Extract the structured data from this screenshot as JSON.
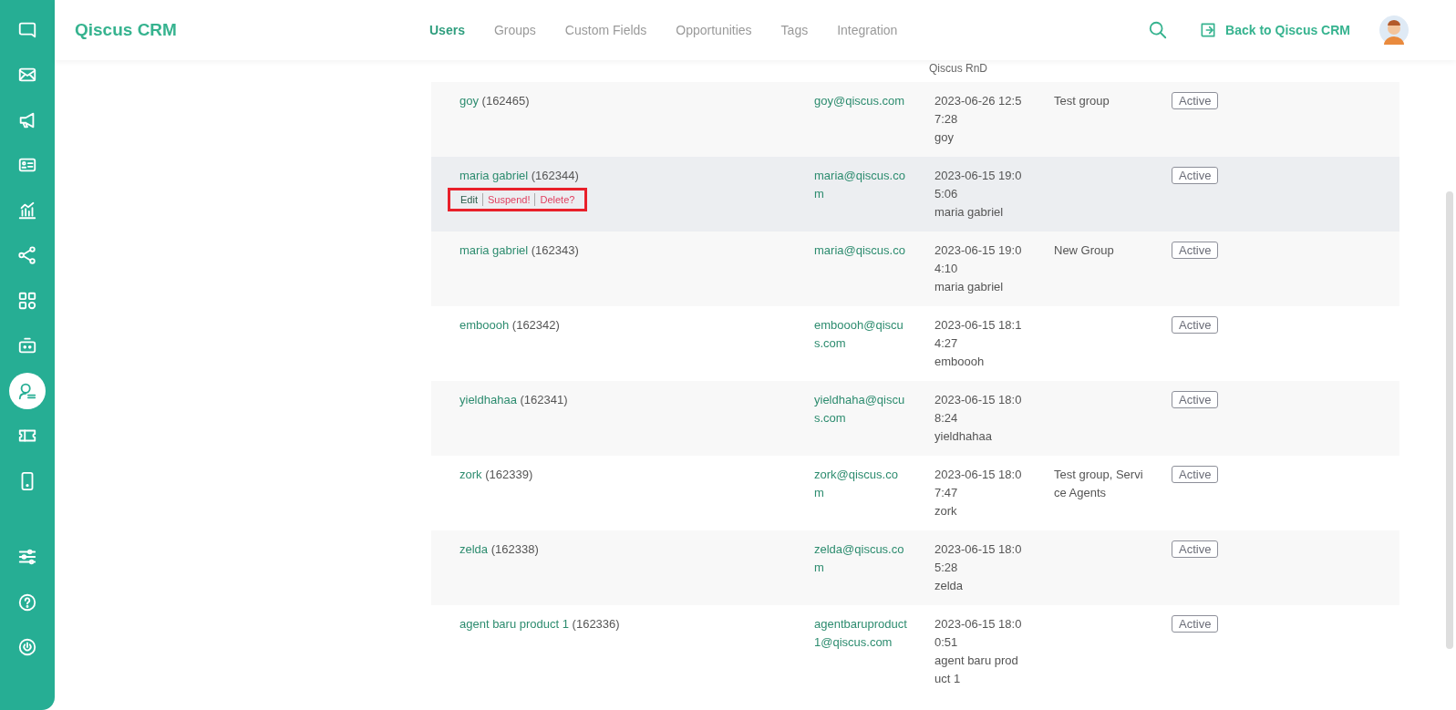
{
  "sidebar": {
    "top_items": [
      {
        "selected": false
      },
      {
        "selected": false
      },
      {
        "selected": false
      },
      {
        "selected": false
      },
      {
        "selected": false
      },
      {
        "selected": false
      },
      {
        "selected": false
      },
      {
        "selected": false
      },
      {
        "selected": true
      },
      {
        "selected": false
      },
      {
        "selected": false
      }
    ],
    "bottom_items": [
      {
        "selected": false
      },
      {
        "selected": false
      },
      {
        "selected": false
      }
    ]
  },
  "header": {
    "title": "Qiscus CRM",
    "tabs": [
      {
        "label": "Users",
        "selected": true
      },
      {
        "label": "Groups",
        "selected": false
      },
      {
        "label": "Custom Fields",
        "selected": false
      },
      {
        "label": "Opportunities",
        "selected": false
      },
      {
        "label": "Tags",
        "selected": false
      },
      {
        "label": "Integration",
        "selected": false
      }
    ],
    "back_link": "Back to Qiscus CRM"
  },
  "table": {
    "partial_row": {
      "created_by": "Qiscus RnD"
    },
    "rows": [
      {
        "name": "goy",
        "id": "(162465)",
        "email": "goy@qiscus.com",
        "created": "2023-06-26 12:57:28",
        "created_by": "goy",
        "groups": "Test group",
        "status": "Active",
        "hovered": false
      },
      {
        "name": "maria gabriel",
        "id": "(162344)",
        "email": "maria@qiscus.com",
        "created": "2023-06-15 19:05:06",
        "created_by": "maria gabriel",
        "status": "Active",
        "hovered": true,
        "actions": [
          {
            "label": "Edit",
            "kind": "edit"
          },
          {
            "label": "Suspend!",
            "kind": "danger"
          },
          {
            "label": "Delete?",
            "kind": "danger"
          }
        ],
        "actions_highlighted": true
      },
      {
        "name": "maria gabriel",
        "id": "(162343)",
        "email": "maria@qiscus.co",
        "created": "2023-06-15 19:04:10",
        "created_by": "maria gabriel",
        "groups": "New Group",
        "status": "Active",
        "hovered": false
      },
      {
        "name": "emboooh",
        "id": "(162342)",
        "email": "emboooh@qiscus.com",
        "created": "2023-06-15 18:14:27",
        "created_by": "emboooh",
        "status": "Active",
        "hovered": false
      },
      {
        "name": "yieldhahaa",
        "id": "(162341)",
        "email": "yieldhaha@qiscus.com",
        "created": "2023-06-15 18:08:24",
        "created_by": "yieldhahaa",
        "status": "Active",
        "hovered": false
      },
      {
        "name": "zork",
        "id": "(162339)",
        "email": "zork@qiscus.com",
        "created": "2023-06-15 18:07:47",
        "created_by": "zork",
        "groups": "Test group, Service Agents",
        "status": "Active",
        "hovered": false
      },
      {
        "name": "zelda",
        "id": "(162338)",
        "email": "zelda@qiscus.com",
        "created": "2023-06-15 18:05:28",
        "created_by": "zelda",
        "status": "Active",
        "hovered": false
      },
      {
        "name": "agent baru product 1",
        "id": "(162336)",
        "email": "agentbaruproduct1@qiscus.com",
        "created": "2023-06-15 18:00:51",
        "created_by": "agent baru product 1",
        "status": "Active",
        "hovered": false
      }
    ]
  }
}
